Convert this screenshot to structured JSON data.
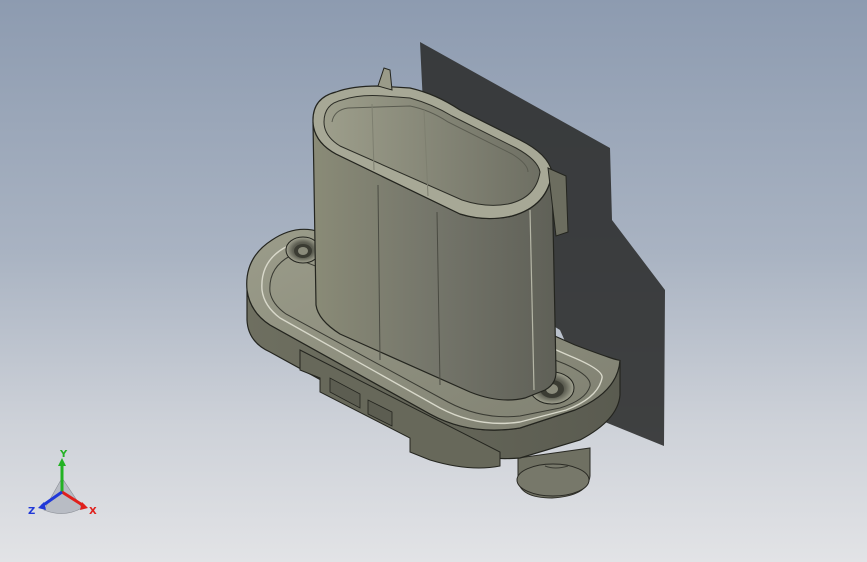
{
  "viewport": {
    "background_top": "#8d9bb0",
    "background_bottom": "#e2e3e6",
    "model_color": "#7e7f6c",
    "shadow_color": "#2f3030"
  },
  "triad": {
    "x_label": "X",
    "y_label": "Y",
    "z_label": "Z",
    "x_color": "#e0201c",
    "y_color": "#23b223",
    "z_color": "#2038d8"
  }
}
